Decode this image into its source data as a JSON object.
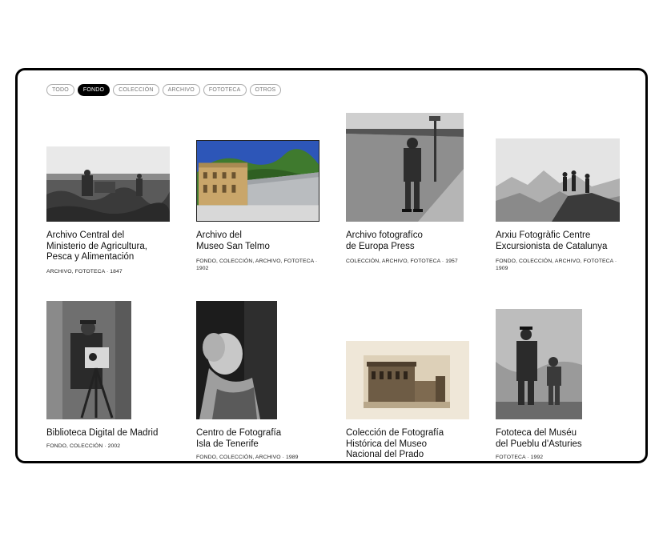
{
  "filters": [
    {
      "label": "TODO"
    },
    {
      "label": "FONDO"
    },
    {
      "label": "COLECCIÓN"
    },
    {
      "label": "ARCHIVO"
    },
    {
      "label": "FOTOTECA"
    },
    {
      "label": "OTROS"
    }
  ],
  "active_filter": "FONDO",
  "cards": [
    {
      "title": "Archivo Central del\nMinisterio de Agricultura,\nPesca y Alimentación",
      "meta": "ARCHIVO, FOTOTECA · 1847"
    },
    {
      "title": "Archivo del\nMuseo San Telmo",
      "meta": "FONDO, COLECCIÓN, ARCHIVO, FOTOTECA ·\n1902"
    },
    {
      "title": "Archivo fotografíco\nde Europa Press",
      "meta": "COLECCIÓN, ARCHIVO, FOTOTECA · 1957"
    },
    {
      "title": "Arxiu Fotogràfic Centre\nExcursionista de Catalunya",
      "meta": "FONDO, COLECCIÓN, ARCHIVO, FOTOTECA ·\n1909"
    },
    {
      "title": "Biblioteca Digital de Madrid",
      "meta": "FONDO, COLECCIÓN · 2002"
    },
    {
      "title": "Centro de Fotografía\nIsla de Tenerife",
      "meta": "FONDO, COLECCIÓN, ARCHIVO · 1989"
    },
    {
      "title": "Colección de Fotografía\nHistórica del Museo\nNacional del Prado",
      "meta": ""
    },
    {
      "title": "Fototeca del Muséu\ndel Pueblu d'Asturies",
      "meta": "FOTOTECA · 1992"
    }
  ]
}
